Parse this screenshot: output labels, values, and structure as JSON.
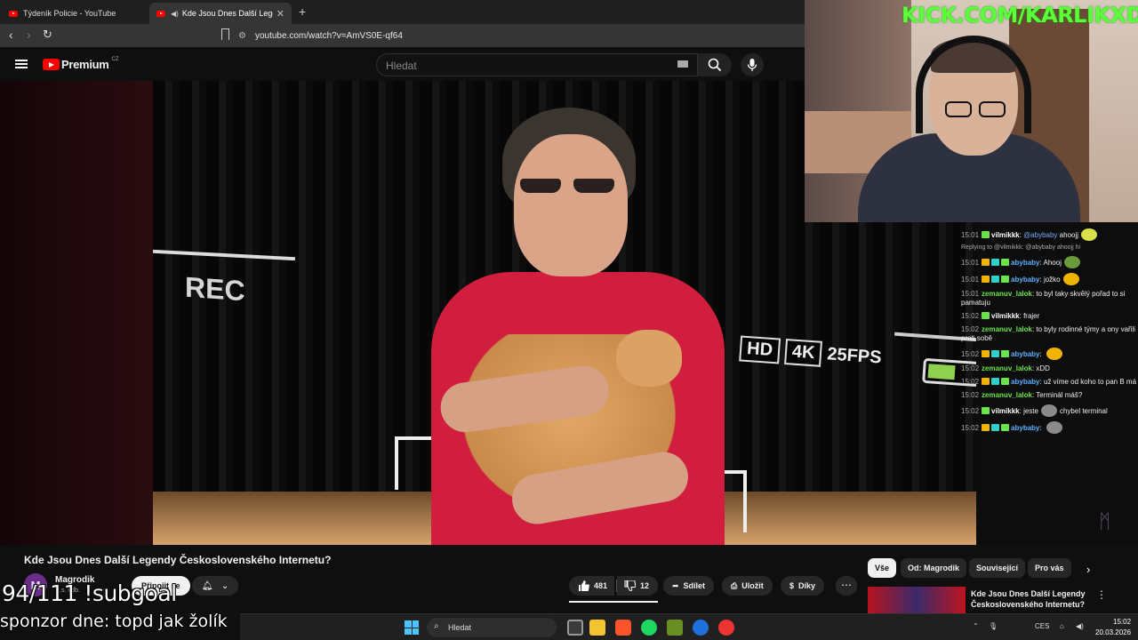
{
  "browser": {
    "tabs": [
      {
        "label": "Týdeník Policie - YouTube"
      },
      {
        "label": "Kde Jsou Dnes Další Legendy Československého Internetu?"
      }
    ],
    "new_tab": "+",
    "url": "youtube.com/watch?v=AmVS0E-qf64"
  },
  "youtube": {
    "logo_text": "Premium",
    "logo_region": "CZ",
    "search_placeholder": "Hledat",
    "video_overlay": {
      "rec": "REC",
      "hd": "HD",
      "res": "4K",
      "fps": "25FPS"
    },
    "title": "Kde Jsou Dnes Další Legendy Československého Internetu?",
    "channel": "Magrodik",
    "channel_initial": "M",
    "subs_partial": "…s. odb.",
    "join_label": "Připojit se",
    "likes": "481",
    "dislikes": "12",
    "share_label": "Sdílet",
    "save_label": "Uložit",
    "thanks_label": "Díky",
    "more_label": "⋯",
    "chips": [
      "Vše",
      "Od: Magrodik",
      "Související",
      "Pro vás"
    ],
    "reco_title": "Kde Jsou Dnes Další Legendy Československého Internetu?"
  },
  "stream": {
    "kick_banner": "KICK.COM/KARLIKXD",
    "subgoal": "94/111 !subgoal",
    "sponsor": "sponzor dne: topd jak žolík",
    "chat": [
      {
        "ts": "15:01",
        "badges": [
          "green"
        ],
        "user": "vilmikkk",
        "user_color": "#ffffff",
        "mention": "@abybaby",
        "text": "ahoojj",
        "emote": "#d8e04a"
      },
      {
        "reply": "Replying to @vilmikkk: @abybaby ahoojj hi"
      },
      {
        "ts": "15:01",
        "badges": [
          "gold",
          "cyan",
          "green"
        ],
        "user": "abybaby",
        "user_color": "#5ab0ff",
        "text": "Ahooj",
        "emote": "#6a9a3a"
      },
      {
        "ts": "15:01",
        "badges": [
          "gold",
          "cyan",
          "green"
        ],
        "user": "abybaby",
        "user_color": "#5ab0ff",
        "text": "jožko",
        "emote": "#f0b400"
      },
      {
        "ts": "15:01",
        "badges": [],
        "user": "zemanuv_lalok",
        "user_color": "#6be34a",
        "text": "to byl taky skvělý pořad to si pamatuju"
      },
      {
        "ts": "15:02",
        "badges": [
          "green"
        ],
        "user": "vilmikkk",
        "user_color": "#ffffff",
        "text": "frajer"
      },
      {
        "ts": "15:02",
        "badges": [],
        "user": "zemanuv_lalok",
        "user_color": "#6be34a",
        "text": "to byly rodinné týmy a ony vařili proti sobě"
      },
      {
        "ts": "15:02",
        "badges": [
          "gold",
          "cyan",
          "green"
        ],
        "user": "abybaby",
        "user_color": "#5ab0ff",
        "text": "",
        "emote": "#f0b400"
      },
      {
        "ts": "15:02",
        "badges": [],
        "user": "zemanuv_lalok",
        "user_color": "#6be34a",
        "text": "xDD"
      },
      {
        "ts": "15:02",
        "badges": [
          "gold",
          "cyan",
          "green"
        ],
        "user": "abybaby",
        "user_color": "#5ab0ff",
        "text": "už víme od koho to pan B má"
      },
      {
        "ts": "15:02",
        "badges": [],
        "user": "zemanuv_lalok",
        "user_color": "#6be34a",
        "text": "Terminál máš?"
      },
      {
        "ts": "15:02",
        "badges": [
          "green"
        ],
        "user": "vilmikkk",
        "user_color": "#ffffff",
        "text": "jeste",
        "text2": "chybel terminal",
        "emote": "#8a8a8a"
      },
      {
        "ts": "15:02",
        "badges": [
          "gold",
          "cyan",
          "green"
        ],
        "user": "abybaby",
        "user_color": "#5ab0ff",
        "text": "",
        "emote": "#8a8a8a"
      }
    ]
  },
  "taskbar": {
    "search_label": "Hledat",
    "lang": "CES",
    "time": "15:02",
    "date": "20.03.2026"
  },
  "colors": {
    "youtube_red": "#ff0000",
    "kick_green": "#5cff3a",
    "shirt_red": "#d11e3e",
    "background": "#0f0f0f"
  }
}
